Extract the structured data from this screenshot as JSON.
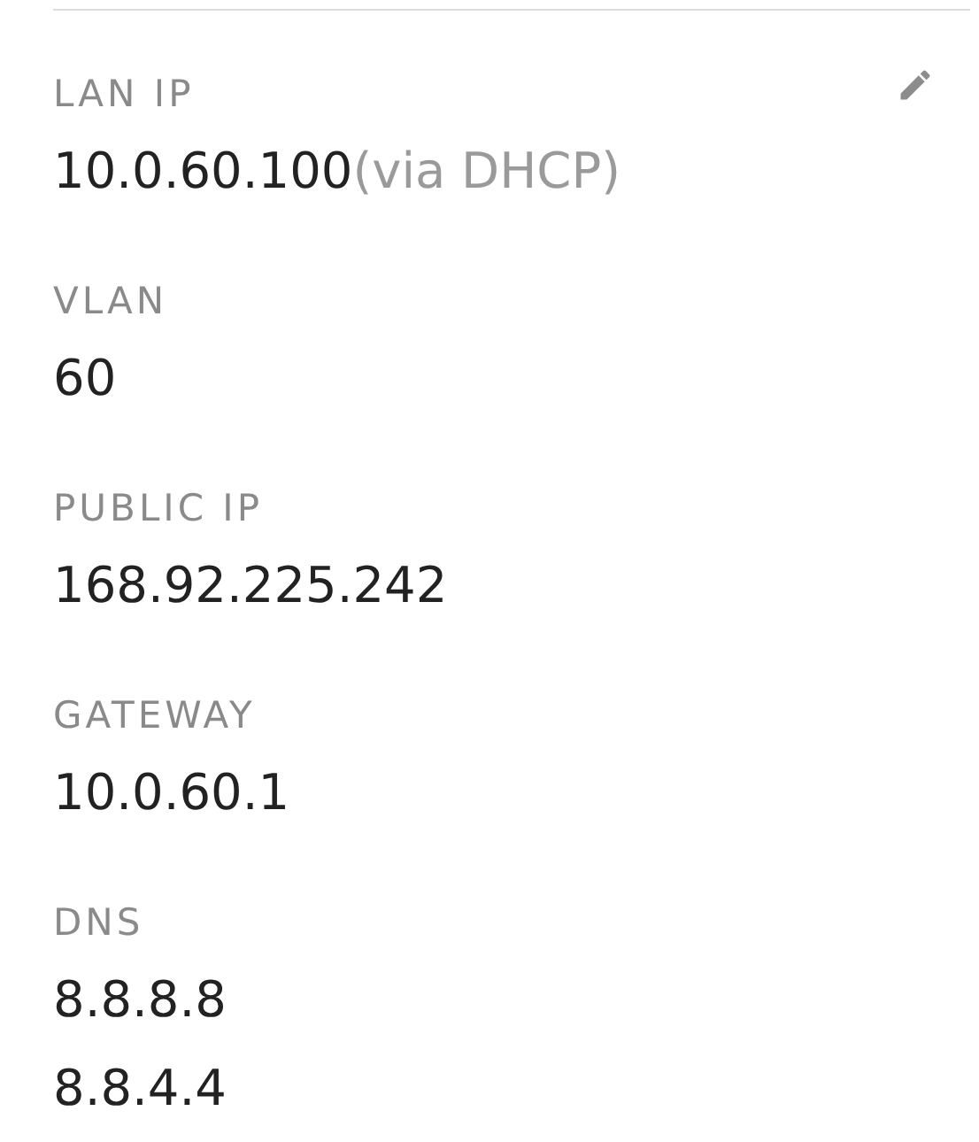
{
  "network": {
    "fields": [
      {
        "label": "LAN IP",
        "values": [
          {
            "text": "10.0.60.100",
            "note": "(via DHCP)"
          }
        ]
      },
      {
        "label": "VLAN",
        "values": [
          {
            "text": "60"
          }
        ]
      },
      {
        "label": "PUBLIC IP",
        "values": [
          {
            "text": "168.92.225.242"
          }
        ]
      },
      {
        "label": "GATEWAY",
        "values": [
          {
            "text": "10.0.60.1"
          }
        ]
      },
      {
        "label": "DNS",
        "values": [
          {
            "text": "8.8.8.8"
          },
          {
            "text": "8.8.4.4"
          }
        ]
      }
    ]
  }
}
